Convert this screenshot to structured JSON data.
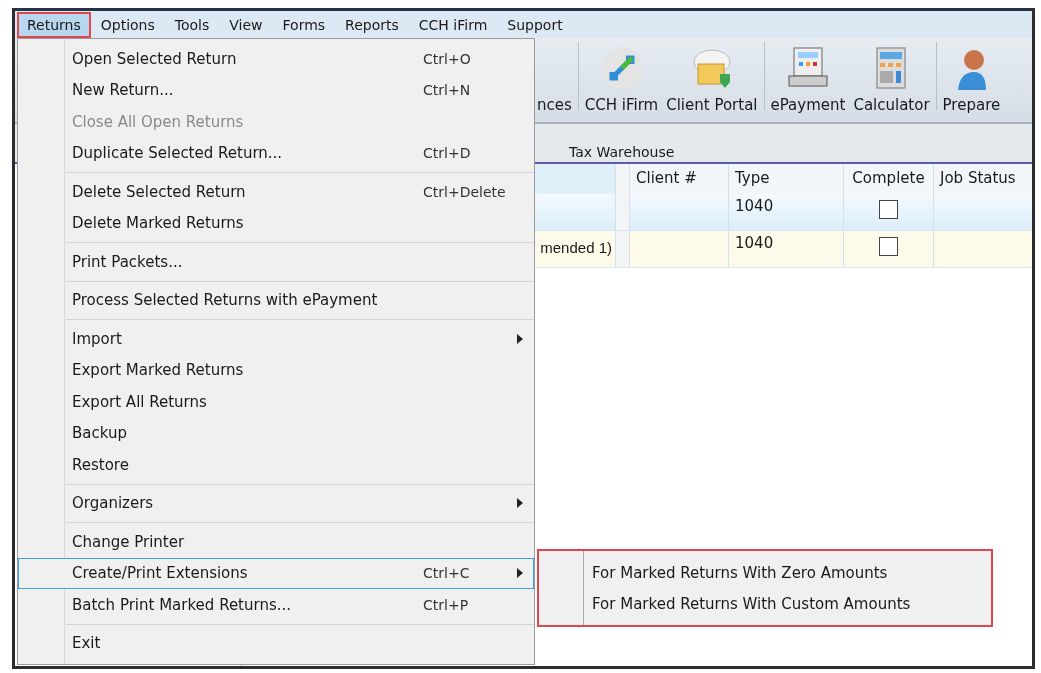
{
  "menubar": [
    {
      "label": "Returns",
      "selected": true
    },
    {
      "label": "Options",
      "selected": false
    },
    {
      "label": "Tools",
      "selected": false
    },
    {
      "label": "View",
      "selected": false
    },
    {
      "label": "Forms",
      "selected": false
    },
    {
      "label": "Reports",
      "selected": false
    },
    {
      "label": "CCH iFirm",
      "selected": false
    },
    {
      "label": "Support",
      "selected": false
    }
  ],
  "toolbar": [
    {
      "label": "nces",
      "kind": "partial"
    },
    {
      "label": "CCH iFirm",
      "kind": "ifirm"
    },
    {
      "label": "Client Portal",
      "kind": "portal"
    },
    {
      "label": "ePayment",
      "kind": "register"
    },
    {
      "label": "Calculator",
      "kind": "calculator"
    },
    {
      "label": "Prepare",
      "kind": "person"
    }
  ],
  "tab": {
    "label": "Tax Warehouse"
  },
  "grid": {
    "columns": [
      "Client #",
      "Type",
      "Complete",
      "Job Status"
    ],
    "rows": [
      {
        "column_1": "",
        "client": "",
        "type": "1040",
        "complete": false,
        "selected": true
      },
      {
        "column_1": "mended 1)",
        "client": "",
        "type": "1040",
        "complete": false,
        "selected": false
      }
    ]
  },
  "menu": {
    "groups": [
      [
        {
          "label": "Open Selected Return",
          "shortcut": "Ctrl+O",
          "disabled": false,
          "submenu": false,
          "selected": false
        },
        {
          "label": "New Return...",
          "shortcut": "Ctrl+N",
          "disabled": false,
          "submenu": false,
          "selected": false
        },
        {
          "label": "Close All Open Returns",
          "disabled": true,
          "submenu": false,
          "selected": false
        },
        {
          "label": "Duplicate Selected Return...",
          "shortcut": "Ctrl+D",
          "disabled": false,
          "submenu": false,
          "selected": false
        }
      ],
      [
        {
          "label": "Delete Selected Return",
          "shortcut": "Ctrl+Delete",
          "disabled": false,
          "submenu": false,
          "selected": false
        },
        {
          "label": "Delete Marked Returns",
          "disabled": false,
          "submenu": false,
          "selected": false
        }
      ],
      [
        {
          "label": "Print Packets...",
          "disabled": false,
          "submenu": false,
          "selected": false
        }
      ],
      [
        {
          "label": "Process Selected Returns with ePayment",
          "disabled": false,
          "submenu": false,
          "selected": false
        }
      ],
      [
        {
          "label": "Import",
          "disabled": false,
          "submenu": true,
          "selected": false
        },
        {
          "label": "Export Marked Returns",
          "disabled": false,
          "submenu": false,
          "selected": false
        },
        {
          "label": "Export All Returns",
          "disabled": false,
          "submenu": false,
          "selected": false
        },
        {
          "label": "Backup",
          "disabled": false,
          "submenu": false,
          "selected": false
        },
        {
          "label": "Restore",
          "disabled": false,
          "submenu": false,
          "selected": false
        }
      ],
      [
        {
          "label": "Organizers",
          "disabled": false,
          "submenu": true,
          "selected": false
        }
      ],
      [
        {
          "label": "Change Printer",
          "disabled": false,
          "submenu": false,
          "selected": false
        },
        {
          "label": "Create/Print Extensions",
          "shortcut": "Ctrl+C",
          "disabled": false,
          "submenu": true,
          "selected": true
        },
        {
          "label": "Batch Print Marked Returns...",
          "shortcut": "Ctrl+P",
          "disabled": false,
          "submenu": false,
          "selected": false
        }
      ],
      [
        {
          "label": "Exit",
          "disabled": false,
          "submenu": false,
          "selected": false
        }
      ]
    ]
  },
  "submenu": {
    "items": [
      "For Marked Returns With Zero Amounts",
      "For Marked Returns With Custom Amounts"
    ]
  }
}
